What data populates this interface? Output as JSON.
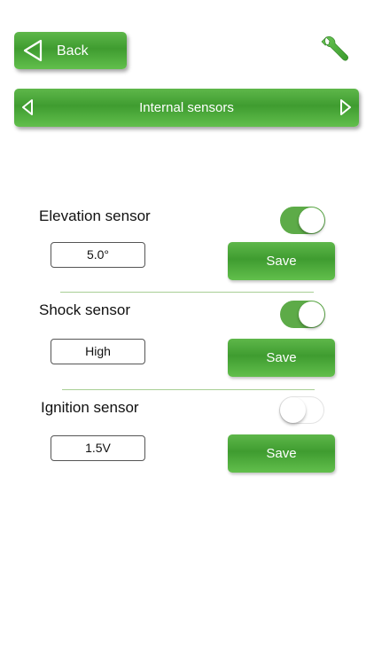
{
  "header": {
    "back_label": "Back",
    "settings_icon": "wrench-icon"
  },
  "nav": {
    "title": "Internal sensors",
    "prev_icon": "triangle-left-icon",
    "next_icon": "triangle-right-icon"
  },
  "sensors": [
    {
      "label": "Elevation sensor",
      "enabled": true,
      "value": "5.0°",
      "save_label": "Save"
    },
    {
      "label": "Shock sensor",
      "enabled": true,
      "value": "High",
      "save_label": "Save"
    },
    {
      "label": "Ignition sensor",
      "enabled": false,
      "value": "1.5V",
      "save_label": "Save"
    }
  ],
  "colors": {
    "accent_green": "#4aa83a",
    "toggle_on": "#5dab48",
    "divider": "#a8cf94"
  }
}
